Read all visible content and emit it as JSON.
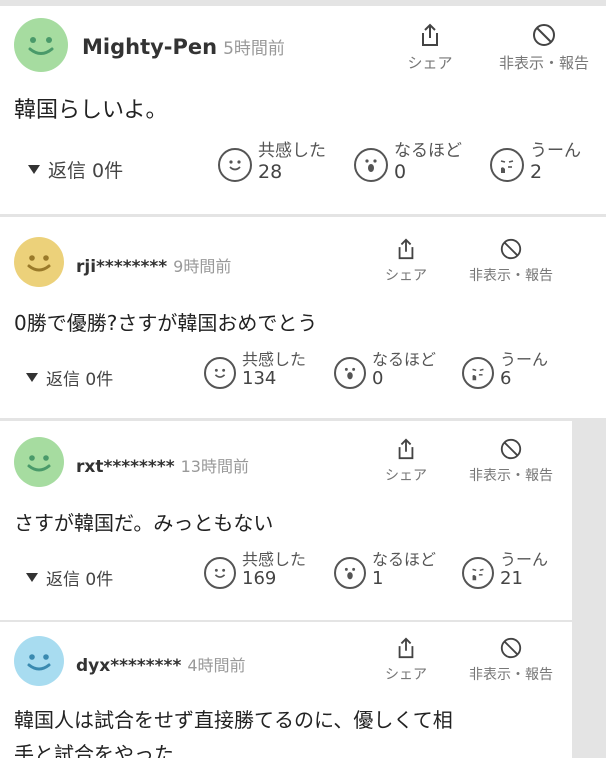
{
  "comments": [
    {
      "avatar_color": "#a6dca0",
      "username": "Mighty-Pen",
      "time": "5時間前",
      "share_label": "シェア",
      "hide_label": "非表示・報告",
      "text": "韓国らしいよ。",
      "replies": "返信 0件",
      "reactions": [
        {
          "label": "共感した",
          "count": "28",
          "icon": "smile-face-icon"
        },
        {
          "label": "なるほど",
          "count": "0",
          "icon": "surprised-face-icon"
        },
        {
          "label": "うーん",
          "count": "2",
          "icon": "thinking-face-icon"
        }
      ]
    },
    {
      "avatar_color": "#ecd17a",
      "username": "rji********",
      "time": "9時間前",
      "share_label": "シェア",
      "hide_label": "非表示・報告",
      "text": "0勝で優勝?さすが韓国おめでとう",
      "replies": "返信 0件",
      "reactions": [
        {
          "label": "共感した",
          "count": "134",
          "icon": "smile-face-icon"
        },
        {
          "label": "なるほど",
          "count": "0",
          "icon": "surprised-face-icon"
        },
        {
          "label": "うーん",
          "count": "6",
          "icon": "thinking-face-icon"
        }
      ]
    },
    {
      "avatar_color": "#a6dca0",
      "username": "rxt********",
      "time": "13時間前",
      "share_label": "シェア",
      "hide_label": "非表示・報告",
      "text": "さすが韓国だ。みっともない",
      "replies": "返信 0件",
      "reactions": [
        {
          "label": "共感した",
          "count": "169",
          "icon": "smile-face-icon"
        },
        {
          "label": "なるほど",
          "count": "1",
          "icon": "surprised-face-icon"
        },
        {
          "label": "うーん",
          "count": "21",
          "icon": "thinking-face-icon"
        }
      ]
    },
    {
      "avatar_color": "#a8dcf0",
      "username": "dyx********",
      "time": "4時間前",
      "share_label": "シェア",
      "hide_label": "非表示・報告",
      "text": "韓国人は試合をせず直接勝てるのに、優しくて相",
      "text2": "手と試合をやった"
    }
  ]
}
